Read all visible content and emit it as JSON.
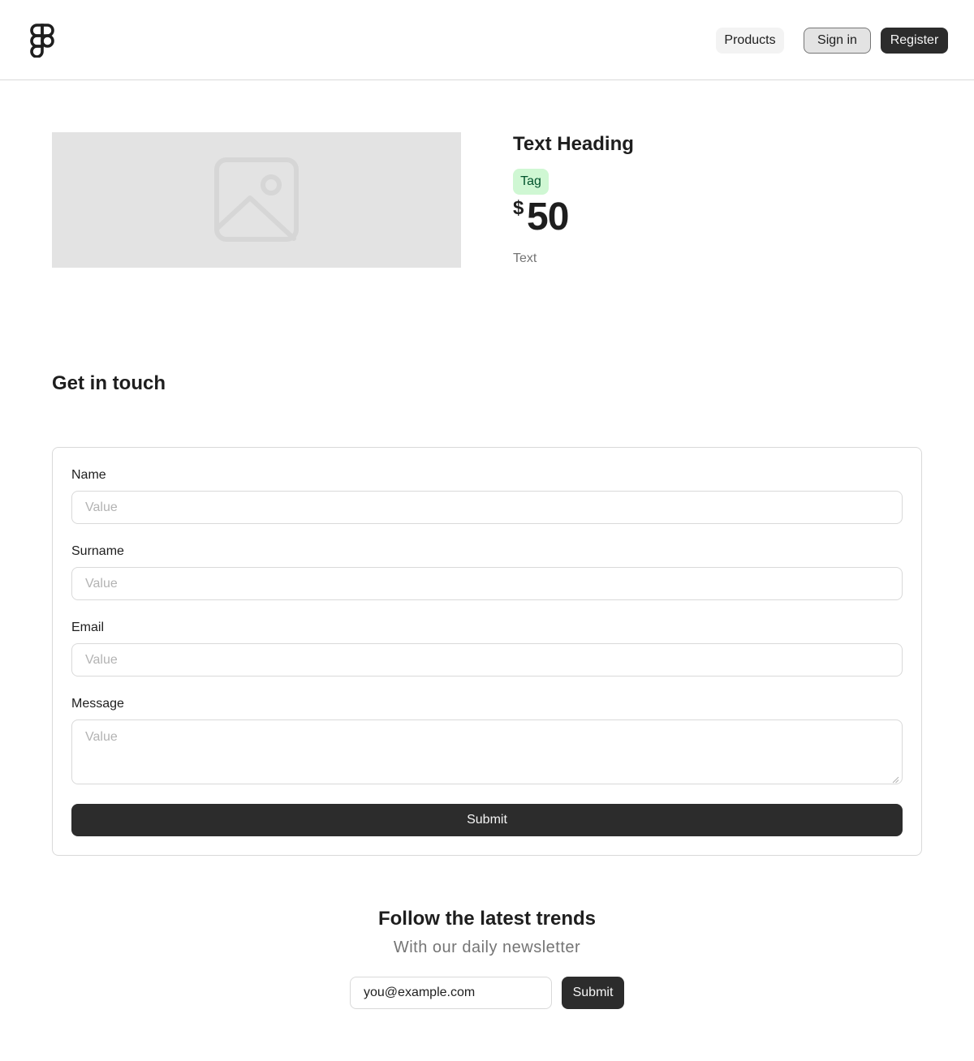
{
  "header": {
    "logo_icon": "figma-logo-icon",
    "nav": {
      "products_label": "Products",
      "signin_label": "Sign in",
      "register_label": "Register"
    }
  },
  "product": {
    "image_icon": "image-placeholder-icon",
    "heading": "Text Heading",
    "tag": "Tag",
    "price_currency": "$",
    "price_value": "50",
    "text": "Text"
  },
  "contact": {
    "title": "Get in touch",
    "fields": [
      {
        "label": "Name",
        "placeholder": "Value",
        "value": ""
      },
      {
        "label": "Surname",
        "placeholder": "Value",
        "value": ""
      },
      {
        "label": "Email",
        "placeholder": "Value",
        "value": ""
      },
      {
        "label": "Message",
        "placeholder": "Value",
        "value": ""
      }
    ],
    "submit_label": "Submit"
  },
  "newsletter": {
    "title": "Follow the latest trends",
    "subtitle": "With our daily newsletter",
    "email_value": "you@example.com",
    "submit_label": "Submit"
  },
  "colors": {
    "primary_button": "#2c2c2c",
    "tag_background": "#cff7d3",
    "tag_text": "#02542d",
    "muted_text": "#757575",
    "border": "#d9d9d9"
  }
}
